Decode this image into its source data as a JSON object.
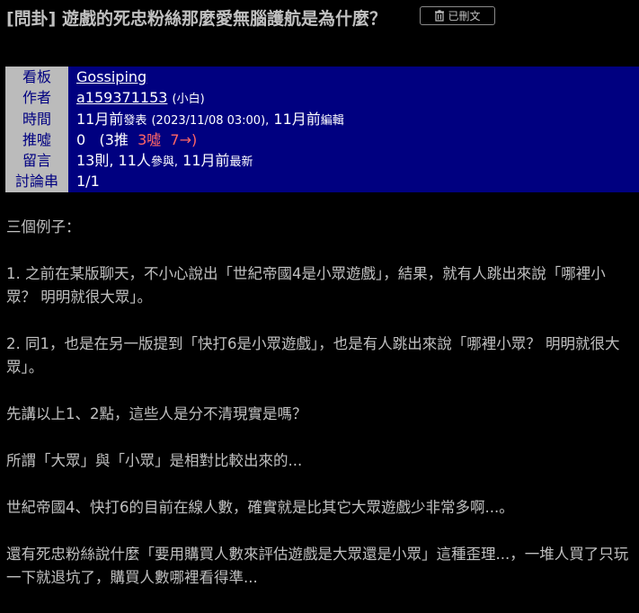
{
  "post": {
    "title": "[問卦] 遊戲的死忠粉絲那麼愛無腦護航是為什麼？",
    "copy_label": "已刪文"
  },
  "meta": {
    "board_label": "看板",
    "board_value": "Gossiping",
    "author_label": "作者",
    "author_id": "a159371153",
    "author_nick": "(小白)",
    "time_label": "時間",
    "time_rel": "11月前",
    "time_posted_word": "發表",
    "time_abs": "(2023/11/08 03:00),",
    "time_edit_rel": "11月前",
    "time_edit_word": "編輯",
    "votes_label": "推噓",
    "votes_total": "0",
    "votes_open": "(3推",
    "votes_boo": "3噓",
    "votes_arrow": "7→)",
    "comments_label": "留言",
    "comments_count": "13則,",
    "comments_people": "11人",
    "comments_people_word": "參與,",
    "comments_latest_rel": "11月前",
    "comments_latest_word": "最新",
    "thread_label": "討論串",
    "thread_value": "1/1"
  },
  "body": {
    "paragraphs": [
      "三個例子：",
      "1. 之前在某版聊天，不小心說出「世紀帝國4是小眾遊戲」，結果，就有人跳出來說「哪裡小眾？ 明明就很大眾」。",
      "2. 同1，也是在另一版提到「快打6是小眾遊戲」，也是有人跳出來說「哪裡小眾？ 明明就很大眾」。",
      "先講以上1、2點，這些人是分不清現實是嗎？",
      "所謂「大眾」與「小眾」是相對比較出來的...",
      "世紀帝國4、快打6的目前在線人數，確實就是比其它大眾遊戲少非常多啊...。",
      "還有死忠粉絲說什麼「要用購買人數來評估遊戲是大眾還是小眾」這種歪理...，一堆人買了只玩一下就退坑了，購買人數哪裡看得準..."
    ]
  },
  "colors": {
    "background": "#000000",
    "meta_value_bg": "#000080",
    "meta_key_bg": "#bbbbbb",
    "boo": "#ff6666"
  }
}
